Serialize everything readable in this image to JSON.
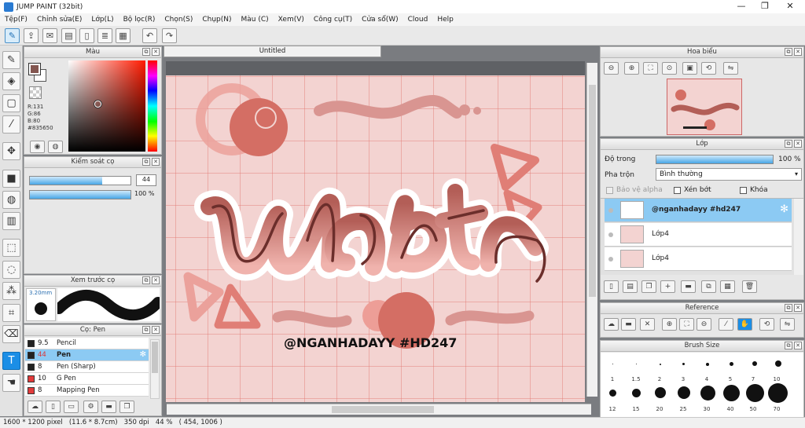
{
  "app": {
    "title": "JUMP PAINT (32bit)"
  },
  "window_controls": {
    "minimize": "—",
    "restore": "❐",
    "close": "✕"
  },
  "menu": [
    "Tệp(F)",
    "Chỉnh sửa(E)",
    "Lớp(L)",
    "Bộ lọc(R)",
    "Chọn(S)",
    "Chụp(N)",
    "Màu (C)",
    "Xem(V)",
    "Công cụ(T)",
    "Cửa sổ(W)",
    "Cloud",
    "Help"
  ],
  "color_panel": {
    "title": "Màu",
    "r": "R:131",
    "g": "G:86",
    "b": "B:80",
    "hex": "#835650",
    "fg_color": "#835650"
  },
  "brush_control": {
    "title": "Kiểm soát cọ",
    "size_value": "44",
    "opacity_value": "100 %",
    "size_fraction": 0.72,
    "opacity_fraction": 1.0
  },
  "brush_preview": {
    "title": "Xem trước cọ",
    "size": "3.20mm"
  },
  "brush_list": {
    "title": "Cọ: Pen",
    "items": [
      {
        "size": "9.5",
        "name": "Pencil",
        "color": "#222222"
      },
      {
        "size": "44",
        "name": "Pen",
        "color": "#222222",
        "selected": true
      },
      {
        "size": "8",
        "name": "Pen (Sharp)",
        "color": "#222222"
      },
      {
        "size": "10",
        "name": "G Pen",
        "color": "#e23b3b"
      },
      {
        "size": "8",
        "name": "Mapping Pen",
        "color": "#e23b3b"
      }
    ]
  },
  "document": {
    "tab": "Untitled",
    "artwork_word": "ulabt",
    "artwork_caption": "@NGANHADAYY #HD247"
  },
  "navigator": {
    "title": "Hoa biểu"
  },
  "layers": {
    "title": "Lớp",
    "opacity_label": "Độ trong",
    "opacity_value": "100 %",
    "blend_label": "Pha trộn",
    "blend_value": "Bình thường",
    "protect_alpha": "Bảo vệ alpha",
    "clip": "Xén bớt",
    "lock": "Khóa",
    "items": [
      {
        "name": "@nganhadayy #hd247",
        "selected": true
      },
      {
        "name": "Lớp4"
      },
      {
        "name": "Lớp4"
      }
    ]
  },
  "reference": {
    "title": "Reference"
  },
  "brush_size": {
    "title": "Brush Size",
    "row1": [
      "1",
      "1.5",
      "2",
      "3",
      "4",
      "5",
      "7",
      "10"
    ],
    "row2": [
      "12",
      "15",
      "20",
      "25",
      "30",
      "40",
      "50",
      "70"
    ]
  },
  "status": {
    "dimensions": "1600 * 1200 pixel",
    "physical": "(11.6 * 8.7cm)",
    "dpi": "350 dpi",
    "zoom": "44 %",
    "coords": "( 454, 1006 )"
  }
}
